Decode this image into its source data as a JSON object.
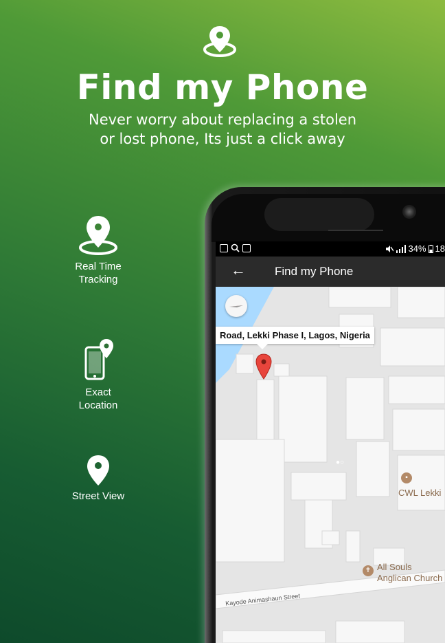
{
  "header": {
    "title": "Find my Phone",
    "subtitle_line1": "Never worry about replacing a stolen",
    "subtitle_line2": "or lost phone, Its just a click away",
    "icon": "location-pin-icon"
  },
  "features": [
    {
      "label": "Real Time\nTracking",
      "icon": "location-pin-icon"
    },
    {
      "label": "Exact\nLocation",
      "icon": "phone-location-icon"
    },
    {
      "label": "Street View",
      "icon": "map-pin-icon"
    }
  ],
  "status_bar": {
    "right_text": "34%",
    "clock_partial": "18"
  },
  "app_bar": {
    "back_glyph": "←",
    "title": "Find my Phone"
  },
  "map": {
    "address_bubble": "Road, Lekki Phase I, Lagos, Nigeria",
    "poi_1": "CWL Lekki",
    "poi_2_line1": "All Souls",
    "poi_2_line2": "Anglican Church",
    "street_name": "Kayode Animashaun Street"
  },
  "colors": {
    "gradient_top": "#8dbb3f",
    "gradient_bottom": "#0e4a2b",
    "pin_red": "#e8453c",
    "water_blue": "#aadaff"
  }
}
